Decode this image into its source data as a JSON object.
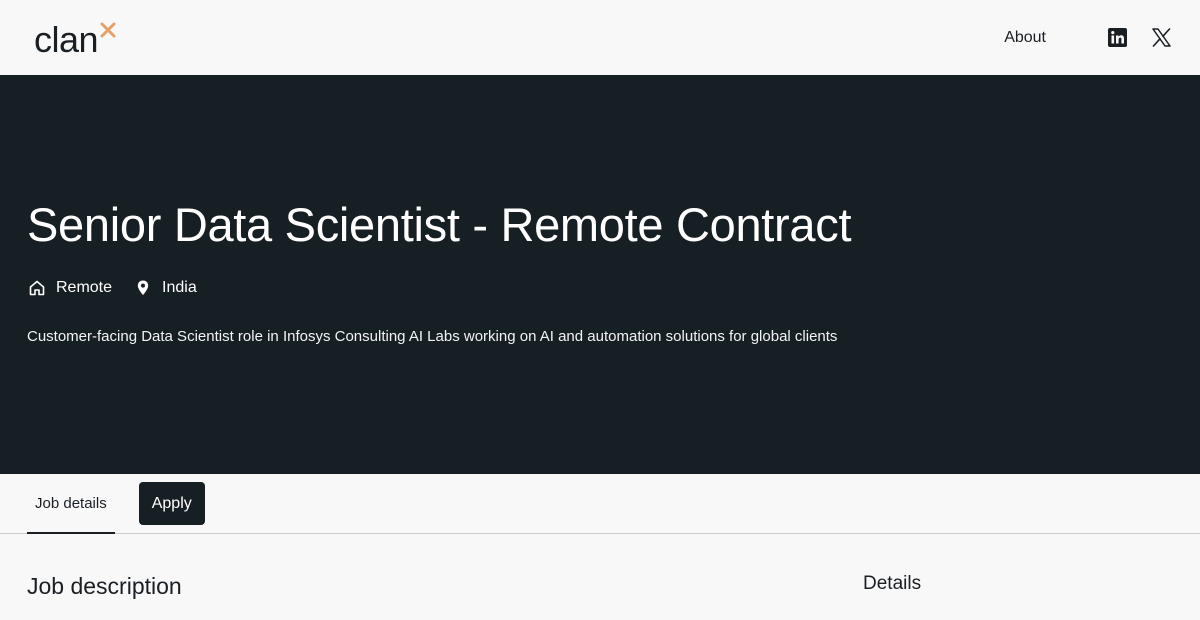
{
  "header": {
    "logo_text": "clan",
    "logo_mark": "x",
    "nav_about": "About",
    "social_icons": [
      "linkedin-icon",
      "x-twitter-icon"
    ]
  },
  "hero": {
    "title": "Senior Data Scientist - Remote Contract",
    "work_mode": "Remote",
    "location": "India",
    "description": "Customer-facing Data Scientist role in Infosys Consulting AI Labs working on AI and automation solutions for global clients"
  },
  "tabs": {
    "job_details": "Job details",
    "apply": "Apply"
  },
  "main": {
    "job_description_title": "Job description",
    "details_title": "Details"
  },
  "colors": {
    "hero_bg": "#161f24",
    "page_bg": "#f8f8f9",
    "logo_accent": "#e8a06a",
    "text_dark": "#1a1f24"
  }
}
